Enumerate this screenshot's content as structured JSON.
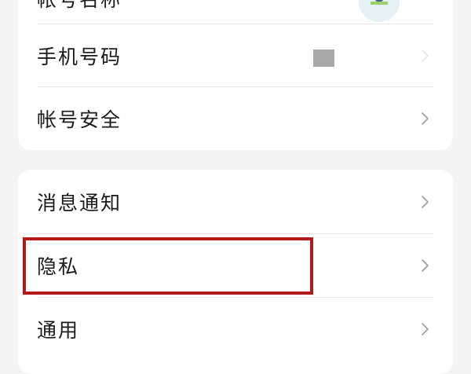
{
  "account_card": {
    "partial_label": "帐号名称",
    "rows": [
      {
        "label": "手机号码"
      },
      {
        "label": "帐号安全"
      }
    ]
  },
  "settings_card": {
    "rows": [
      {
        "label": "消息通知"
      },
      {
        "label": "隐私"
      },
      {
        "label": "通用"
      }
    ]
  },
  "colors": {
    "background": "#f4f4f4",
    "card": "#ffffff",
    "highlight": "#b51a1a",
    "chevron": "#9a9a9a"
  },
  "icons": {
    "row_chevron": "chevron-right-icon",
    "profile_avatar": "avatar-icon"
  }
}
